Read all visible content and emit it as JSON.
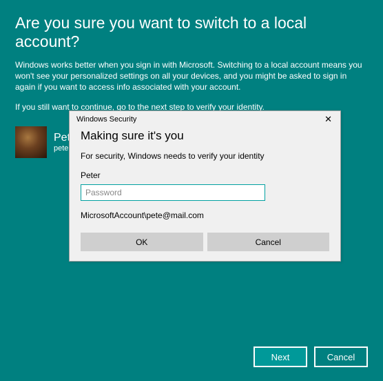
{
  "page": {
    "title": "Are you sure you want to switch to a local account?",
    "paragraph1": "Windows works better when you sign in with Microsoft. Switching to a local account means you won't see your personalized settings on all your devices, and you might be asked to sign in again if you want to access info associated with your account.",
    "paragraph2": "If you still want to continue, go to the next step to verify your identity."
  },
  "user": {
    "name": "Peter",
    "name_truncated": "Pet",
    "email_truncated": "peter"
  },
  "footer": {
    "next_label": "Next",
    "cancel_label": "Cancel"
  },
  "dialog": {
    "window_title": "Windows Security",
    "heading": "Making sure it's you",
    "subtext": "For security, Windows needs to verify your identity",
    "username": "Peter",
    "password_placeholder": "Password",
    "password_value": "",
    "account_line": "MicrosoftAccount\\pete@mail.com",
    "ok_label": "OK",
    "cancel_label": "Cancel"
  }
}
